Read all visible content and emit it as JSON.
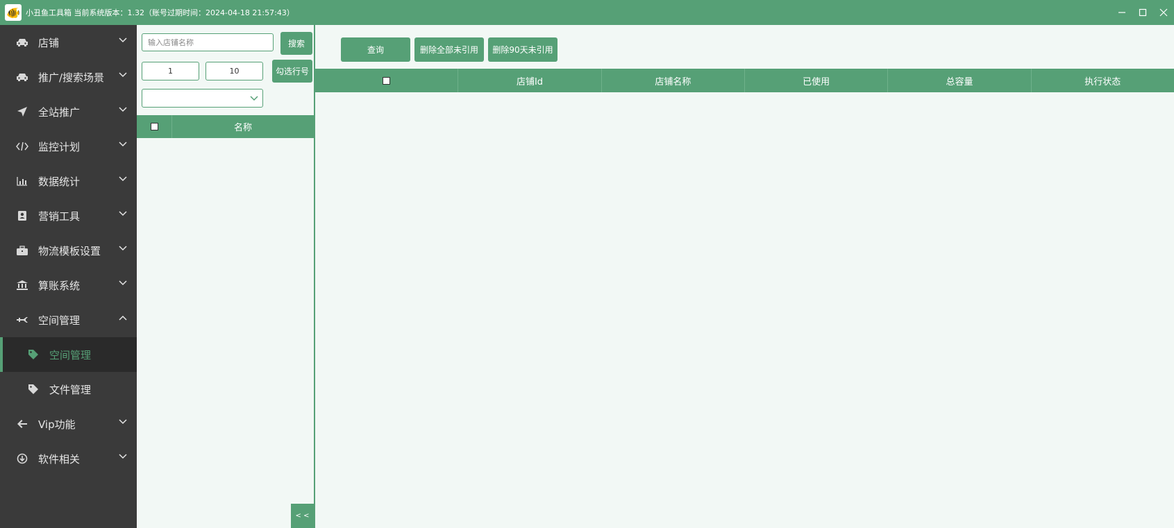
{
  "titlebar": {
    "title": "小丑鱼工具箱 当前系统版本：1.32（账号过期时间：2024-04-18 21:57:43）",
    "minimize": "—",
    "maximize": "☐",
    "close": "✕"
  },
  "sidebar": {
    "items": [
      {
        "label": "店铺",
        "icon": "car-icon"
      },
      {
        "label": "推广/搜索场景",
        "icon": "car-icon"
      },
      {
        "label": "全站推广",
        "icon": "paper-plane-icon"
      },
      {
        "label": "监控计划",
        "icon": "code-icon"
      },
      {
        "label": "数据统计",
        "icon": "bar-chart-icon"
      },
      {
        "label": "营销工具",
        "icon": "contact-book-icon"
      },
      {
        "label": "物流模板设置",
        "icon": "briefcase-icon"
      },
      {
        "label": "算账系统",
        "icon": "bank-icon"
      },
      {
        "label": "空间管理",
        "icon": "plane-icon",
        "expanded": true
      },
      {
        "label": "Vip功能",
        "icon": "arrow-left-icon"
      },
      {
        "label": "软件相关",
        "icon": "download-circle-icon"
      }
    ],
    "subitems": [
      {
        "label": "空间管理",
        "icon": "tag-icon",
        "active": true
      },
      {
        "label": "文件管理",
        "icon": "tag-icon"
      }
    ]
  },
  "left_panel": {
    "search_placeholder": "输入店铺名称",
    "search_button": "搜索",
    "from_value": "1",
    "to_value": "10",
    "select_rows_button": "勾选行号",
    "grid_header": "名称",
    "collapse_label": "< <"
  },
  "main": {
    "query_button": "查询",
    "delete_all_button": "删除全部未引用",
    "delete_90_button": "删除90天未引用",
    "columns": [
      "店铺Id",
      "店铺名称",
      "已使用",
      "总容量",
      "执行状态"
    ]
  },
  "colors": {
    "accent": "#56a076",
    "sidebar_bg": "#3a3a3a",
    "panel_bg": "#f2f8f5"
  }
}
